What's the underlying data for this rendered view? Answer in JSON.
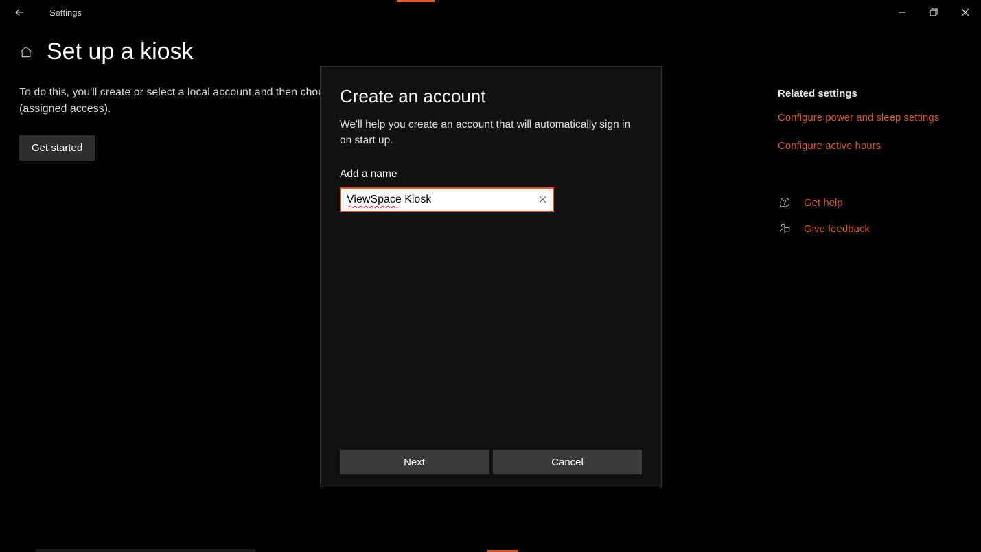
{
  "titlebar": {
    "app_name": "Settings"
  },
  "page": {
    "title": "Set up a kiosk",
    "description": "To do this, you'll create or select a local account and then choose the only app that it can use (assigned access).",
    "get_started_label": "Get started"
  },
  "sidebar": {
    "heading": "Related settings",
    "links": [
      "Configure power and sleep settings",
      "Configure active hours"
    ],
    "help_label": "Get help",
    "feedback_label": "Give feedback"
  },
  "modal": {
    "title": "Create an account",
    "description": "We'll help you create an account that will automatically sign in on start up.",
    "field_label": "Add a name",
    "input_value": "ViewSpace Kiosk",
    "next_label": "Next",
    "cancel_label": "Cancel"
  },
  "colors": {
    "accent": "#d25a33",
    "accent_bright": "#e85c2a"
  }
}
